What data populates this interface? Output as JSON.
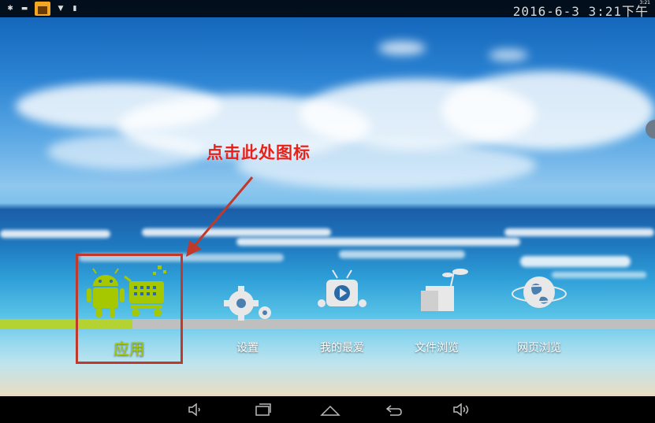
{
  "status_bar": {
    "clock": "2016-6-3 3:21下午",
    "mini_time": "3:21"
  },
  "annotation": {
    "callout_text": "点击此处图标",
    "callout_color": "#e8211b",
    "highlight_color": "#c0392b"
  },
  "dock": {
    "apps": [
      {
        "label": "应用",
        "icon": "android-shopping-cart-icon",
        "selected": true
      },
      {
        "label": "设置",
        "icon": "gears-icon",
        "selected": false
      },
      {
        "label": "我的最爱",
        "icon": "tv-play-icon",
        "selected": false
      },
      {
        "label": "文件浏览",
        "icon": "folder-plant-icon",
        "selected": false
      },
      {
        "label": "网页浏览",
        "icon": "globe-icon",
        "selected": false
      }
    ],
    "accent_color": "#b4d232"
  },
  "nav_bar": {
    "buttons": [
      "volume-down-icon",
      "recents-icon",
      "home-icon",
      "back-icon",
      "volume-up-icon"
    ]
  }
}
